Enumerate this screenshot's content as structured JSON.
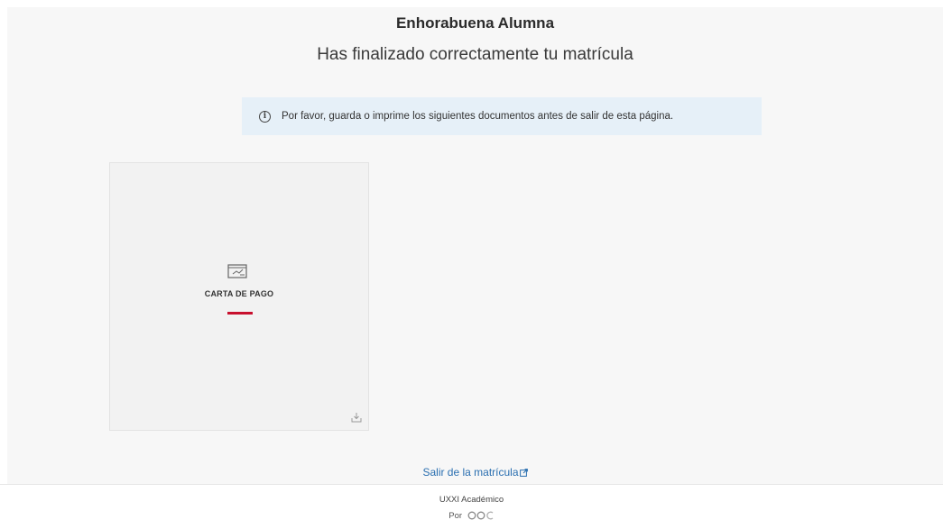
{
  "header": {
    "title": "Enhorabuena Alumna",
    "subtitle": "Has finalizado correctamente tu matrícula"
  },
  "info_banner": {
    "icon": "info-icon",
    "text": "Por favor, guarda o imprime los siguientes documentos antes de salir de esta página."
  },
  "documents": [
    {
      "label": "CARTA DE PAGO",
      "icon": "payment-document-icon",
      "action_icon": "download-icon",
      "accent_color": "#c8102e"
    }
  ],
  "exit_link": {
    "label": "Salir de la matrícula",
    "icon": "external-link-icon"
  },
  "footer": {
    "product": "UXXI Académico",
    "by_label": "Por",
    "brand_icon": "ocu-logo-icon"
  },
  "colors": {
    "background": "#f7f7f7",
    "banner": "#e6f0f8",
    "link": "#2a6fb0",
    "accent": "#c8102e"
  }
}
